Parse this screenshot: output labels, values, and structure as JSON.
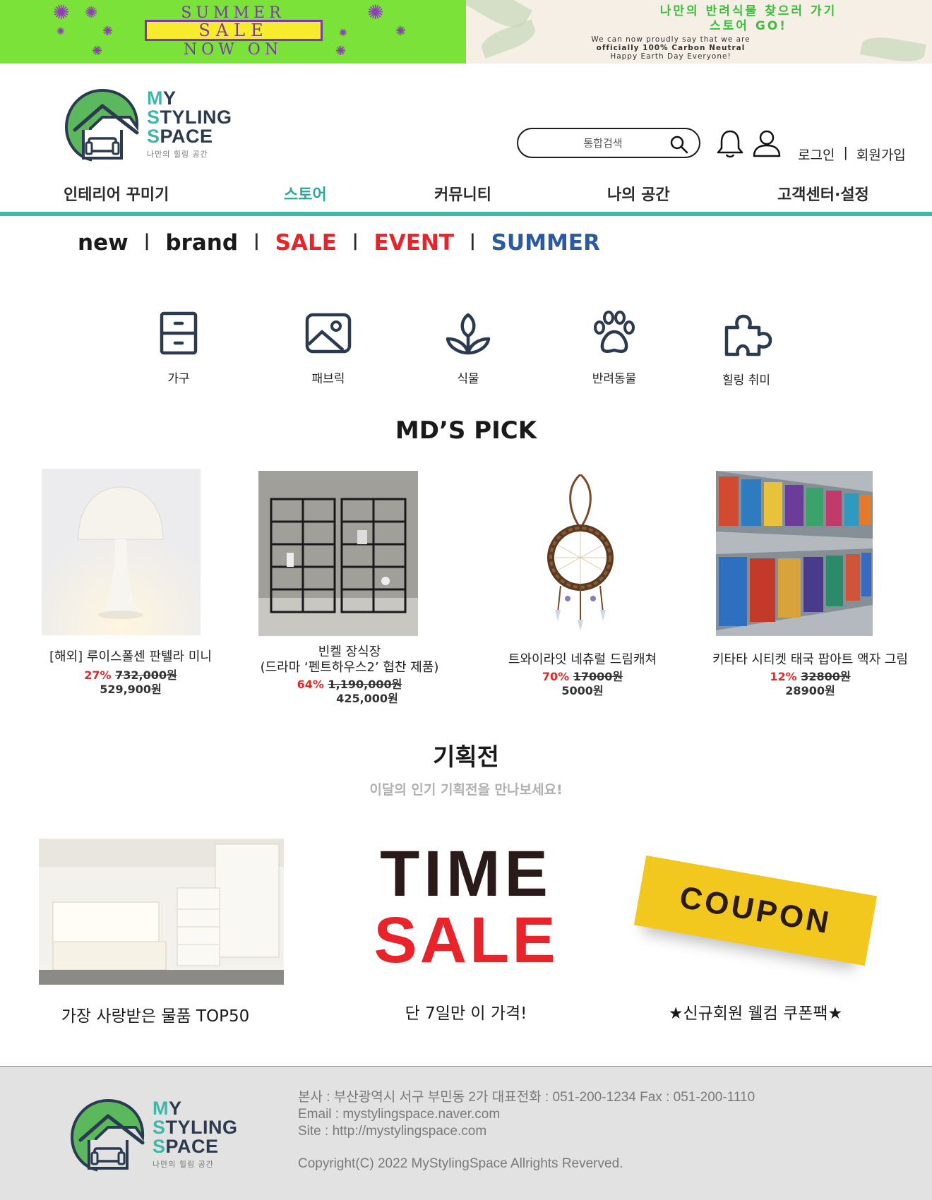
{
  "banners": {
    "summer": {
      "line1": "SUMMER",
      "line2": "SALE",
      "line3": "NOW ON"
    },
    "pet": {
      "title1": "나만의 반려식물 찾으러 가기",
      "title2": "스토어 GO!",
      "text1": "We can now proudly say that we are",
      "text2": "officially 100% Carbon Neutral",
      "text3": "Happy Earth Day Everyone!"
    }
  },
  "header": {
    "logo": {
      "line1": "MY",
      "line2": "STYLING",
      "line3": "SPACE",
      "tagline": "나만의 힐링 공간"
    },
    "search": {
      "placeholder": "통합검색"
    },
    "auth": {
      "login": "로그인",
      "divider": "|",
      "signup": "회원가입"
    }
  },
  "nav": {
    "items": [
      {
        "label": "인테리어 꾸미기"
      },
      {
        "label": "스토어"
      },
      {
        "label": "커뮤니티"
      },
      {
        "label": "나의 공간"
      },
      {
        "label": "고객센터·설정"
      }
    ],
    "active_index": 1
  },
  "subnav": {
    "items": [
      "new",
      "brand",
      "SALE",
      "EVENT",
      "SUMMER"
    ],
    "separator": "l",
    "colors": {
      "new": "#1a1a1a",
      "brand": "#1a1a1a",
      "SALE": "#e8232a",
      "EVENT": "#e8232a",
      "SUMMER": "#2c5aa0"
    }
  },
  "categories": [
    {
      "label": "가구",
      "icon": "drawer-icon"
    },
    {
      "label": "패브릭",
      "icon": "image-icon"
    },
    {
      "label": "식물",
      "icon": "plant-icon"
    },
    {
      "label": "반려동물",
      "icon": "paw-icon"
    },
    {
      "label": "힐링 취미",
      "icon": "puzzle-icon"
    }
  ],
  "md_pick": {
    "title": "MD’S PICK",
    "products": [
      {
        "name": "[해외] 루이스폴센 판텔라 미니",
        "discount": "27%",
        "original": "732,000원",
        "price": "529,900원"
      },
      {
        "name_line1": "빈켈 장식장",
        "name_line2": "(드라마 ‘펜트하우스2’ 협찬 제품)",
        "discount": "64%",
        "original": "1,190,000원",
        "price": "425,000원"
      },
      {
        "name": "트와이라잇 네츄럴 드림캐쳐",
        "discount": "70%",
        "original": "17000원",
        "price": "5000원"
      },
      {
        "name": "키타타 시티켓 태국 팝아트 액자 그림",
        "discount": "12%",
        "original": "32800원",
        "price": "28900원"
      }
    ]
  },
  "promotions": {
    "title": "기획전",
    "subtitle": "이달의 인기 기획전을 만나보세요!",
    "items": [
      {
        "label": "가장 사랑받은 물품 TOP50"
      },
      {
        "label": "단 7일만 이 가격!",
        "image_text1": "TIME",
        "image_text2": "SALE"
      },
      {
        "label": "★신규회원 웰컴 쿠폰팩★",
        "image_text": "COUPON"
      }
    ]
  },
  "footer": {
    "logo": {
      "line1": "MY",
      "line2": "STYLING",
      "line3": "SPACE",
      "tagline": "나만의 힐링 공간"
    },
    "address": "본사 : 부산광역시 서구 부민동 2가  대표전화 : 051-200-1234 Fax : 051-200-1110",
    "email": "Email : mystylingspace.naver.com",
    "site": "Site : http://mystylingspace.com",
    "copyright": "Copyright(C) 2022 MyStylingSpace Allrights Reverved."
  },
  "colors": {
    "accent": "#3fb7a8",
    "sale_red": "#e22a2a",
    "summer_blue": "#2c5aa0",
    "banner_green": "#7be23a"
  }
}
